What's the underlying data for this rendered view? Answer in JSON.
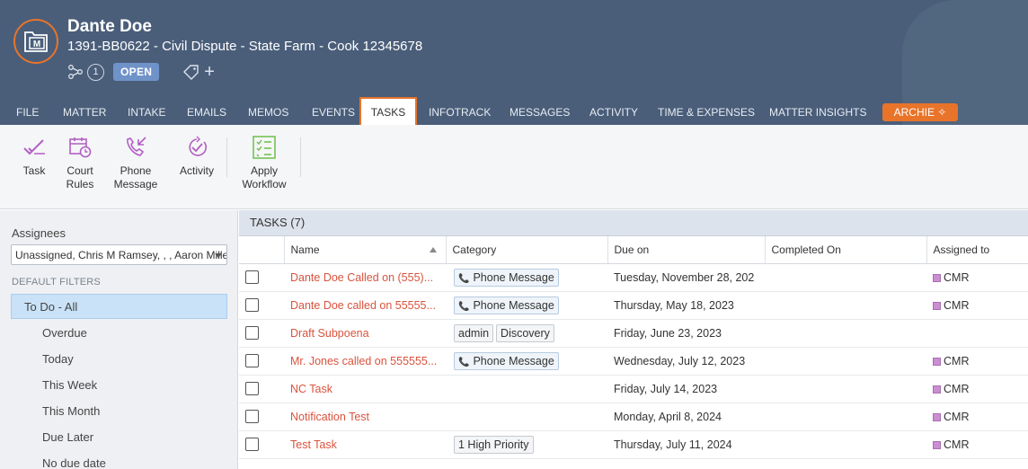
{
  "header": {
    "client_name": "Dante Doe",
    "matter_title": "1391-BB0622 - Civil Dispute - State Farm - Cook 12345678",
    "related_count": "1",
    "status": "OPEN",
    "avatar_icon": "matter-folder-icon"
  },
  "tabs": [
    {
      "label": "FILE"
    },
    {
      "label": "MATTER"
    },
    {
      "label": "INTAKE"
    },
    {
      "label": "EMAILS"
    },
    {
      "label": "MEMOS"
    },
    {
      "label": "EVENTS"
    },
    {
      "label": "TASKS",
      "active": true
    },
    {
      "label": "INFOTRACK"
    },
    {
      "label": "MESSAGES"
    },
    {
      "label": "ACTIVITY"
    },
    {
      "label": "TIME & EXPENSES"
    },
    {
      "label": "MATTER INSIGHTS"
    }
  ],
  "archie": {
    "label": "ARCHIE ✧"
  },
  "toolbar": {
    "task": "Task",
    "court_rules_1": "Court",
    "court_rules_2": "Rules",
    "phone_message_1": "Phone",
    "phone_message_2": "Message",
    "activity": "Activity",
    "apply_workflow_1": "Apply",
    "apply_workflow_2": "Workflow"
  },
  "sidebar": {
    "assignees_label": "Assignees",
    "assignees_value": "Unassigned, Chris M Ramsey,  ,  , Aaron Miller",
    "filters_heading": "DEFAULT FILTERS",
    "filters": [
      {
        "label": "To Do - All",
        "selected": true
      },
      {
        "label": "Overdue"
      },
      {
        "label": "Today"
      },
      {
        "label": "This Week"
      },
      {
        "label": "This Month"
      },
      {
        "label": "Due Later"
      },
      {
        "label": "No due date"
      }
    ]
  },
  "tasks": {
    "title": "TASKS (7)",
    "columns": {
      "name": "Name",
      "category": "Category",
      "due": "Due on",
      "completed": "Completed On",
      "assigned": "Assigned to"
    },
    "rows": [
      {
        "name": "Dante Doe Called on (555)...",
        "categories": [
          {
            "label": "Phone Message",
            "phone": true
          }
        ],
        "due": "Tuesday, November 28, 202",
        "completed": "",
        "assigned": "CMR"
      },
      {
        "name": "Dante Doe called on 55555...",
        "categories": [
          {
            "label": "Phone Message",
            "phone": true
          }
        ],
        "due": "Thursday, May 18, 2023",
        "completed": "",
        "assigned": "CMR"
      },
      {
        "name": "Draft Subpoena",
        "categories": [
          {
            "label": "admin"
          },
          {
            "label": "Discovery"
          }
        ],
        "due": "Friday, June 23, 2023",
        "completed": "",
        "assigned": ""
      },
      {
        "name": "Mr. Jones called on 555555...",
        "categories": [
          {
            "label": "Phone Message",
            "phone": true
          }
        ],
        "due": "Wednesday, July 12, 2023",
        "completed": "",
        "assigned": "CMR"
      },
      {
        "name": "NC Task",
        "categories": [],
        "due": "Friday, July 14, 2023",
        "completed": "",
        "assigned": "CMR"
      },
      {
        "name": "Notification Test",
        "categories": [],
        "due": "Monday, April 8, 2024",
        "completed": "",
        "assigned": "CMR"
      },
      {
        "name": "Test Task",
        "categories": [
          {
            "label": "1 High Priority"
          }
        ],
        "due": "Thursday, July 11, 2024",
        "completed": "",
        "assigned": "CMR"
      }
    ]
  },
  "colors": {
    "header_bg": "#4a5e7a",
    "accent_orange": "#e8742a",
    "task_link": "#d9533d",
    "toolbar_icon": "#b25fc4",
    "workflow_icon": "#6dbf4b",
    "selected_filter": "#c9e2f7"
  }
}
